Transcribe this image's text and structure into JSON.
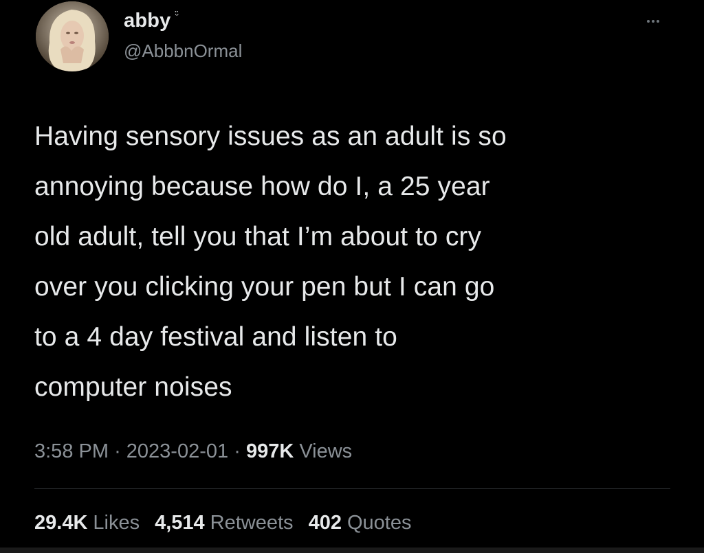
{
  "author": {
    "display_name": "abby",
    "emoji": "ᵕ̈",
    "handle": "@AbbbnOrmal"
  },
  "tweet": {
    "text": "Having sensory issues as an adult is so\nannoying because how do I, a 25 year\nold adult, tell you that I’m about to cry\nover you clicking your pen but I can go\nto a 4 day festival and listen to\ncomputer noises"
  },
  "meta": {
    "time": "3:58 PM",
    "separator": "·",
    "date": "2023-02-01",
    "views_count": "997K",
    "views_label": "Views"
  },
  "stats": {
    "likes_count": "29.4K",
    "likes_label": "Likes",
    "retweets_count": "4,514",
    "retweets_label": "Retweets",
    "quotes_count": "402",
    "quotes_label": "Quotes"
  },
  "icons": {
    "more": "more-horizontal-icon"
  },
  "colors": {
    "background": "#000000",
    "primary_text": "#e7e9ea",
    "secondary_text": "#8b9197",
    "divider": "#2f3336"
  }
}
